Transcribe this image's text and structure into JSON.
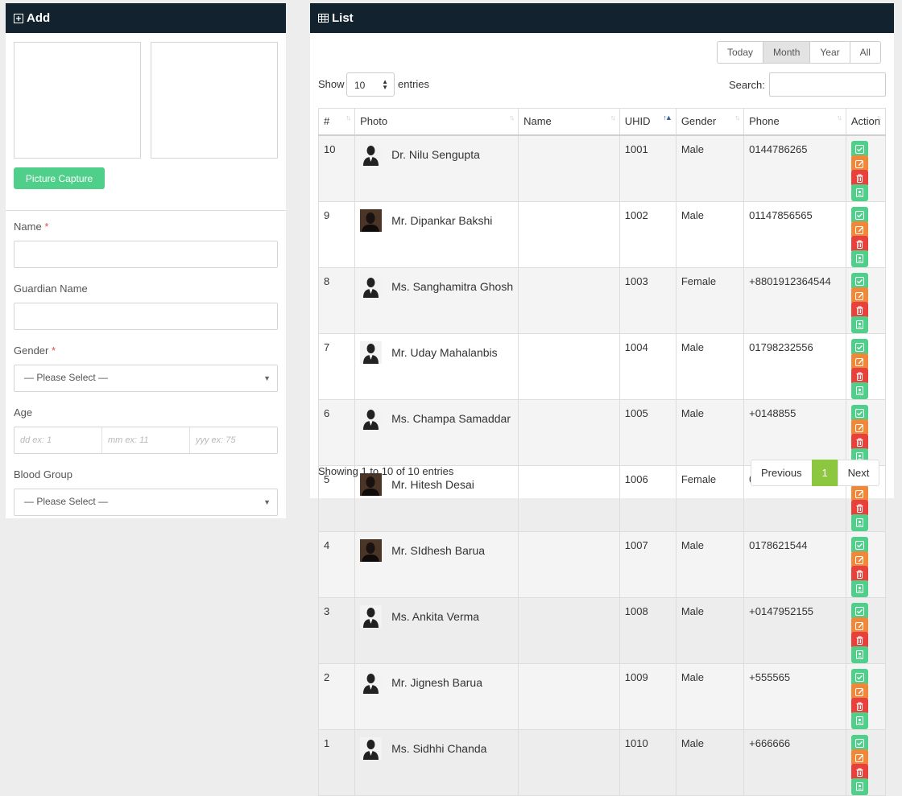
{
  "add_panel": {
    "title": "Add",
    "capture_button": "Picture Capture",
    "name_label": "Name",
    "guardian_label": "Guardian Name",
    "gender_label": "Gender",
    "gender_value": "— Please Select —",
    "age_label": "Age",
    "age_dd_placeholder": "dd ex: 1",
    "age_mm_placeholder": "mm ex: 11",
    "age_yy_placeholder": "yyy ex: 75",
    "blood_label": "Blood Group",
    "blood_value": "— Please Select —",
    "required_mark": "*"
  },
  "list_panel": {
    "title": "List",
    "ranges": [
      "Today",
      "Month",
      "Year",
      "All"
    ],
    "active_range": "Month",
    "show_label": "Show",
    "entries_label": "entries",
    "page_length": "10",
    "search_label": "Search:",
    "columns": [
      "#",
      "Photo",
      "Name",
      "UHID",
      "Gender",
      "Phone",
      "Action"
    ],
    "rows": [
      {
        "num": "10",
        "name": "Dr. Nilu Sengupta",
        "uhid": "1001",
        "gender": "Male",
        "phone": "0144786265",
        "photo": "silhouette"
      },
      {
        "num": "9",
        "name": "Mr. Dipankar Bakshi",
        "uhid": "1002",
        "gender": "Male",
        "phone": "01147856565",
        "photo": "photo"
      },
      {
        "num": "8",
        "name": "Ms. Sanghamitra Ghosh",
        "uhid": "1003",
        "gender": "Female",
        "phone": "+8801912364544",
        "photo": "silhouette"
      },
      {
        "num": "7",
        "name": "Mr. Uday Mahalanbis",
        "uhid": "1004",
        "gender": "Male",
        "phone": "01798232556",
        "photo": "silhouette"
      },
      {
        "num": "6",
        "name": "Ms. Champa Samaddar",
        "uhid": "1005",
        "gender": "Male",
        "phone": "+0148855",
        "photo": "silhouette"
      },
      {
        "num": "5",
        "name": "Mr. Hitesh Desai",
        "uhid": "1006",
        "gender": "Female",
        "phone": "0148625552",
        "photo": "photo"
      },
      {
        "num": "4",
        "name": "Mr. SIdhesh Barua",
        "uhid": "1007",
        "gender": "Male",
        "phone": "0178621544",
        "photo": "photo"
      },
      {
        "num": "3",
        "name": "Ms. Ankita Verma",
        "uhid": "1008",
        "gender": "Male",
        "phone": "+0147952155",
        "photo": "silhouette"
      },
      {
        "num": "2",
        "name": "Mr. Jignesh Barua",
        "uhid": "1009",
        "gender": "Male",
        "phone": "+555565",
        "photo": "silhouette"
      },
      {
        "num": "1",
        "name": "Ms. Sidhhi Chanda",
        "uhid": "1010",
        "gender": "Male",
        "phone": "+666666",
        "photo": "silhouette"
      }
    ],
    "actions": [
      "check-icon",
      "edit-icon",
      "trash-icon",
      "id-card-icon"
    ],
    "info": "Showing 1 to 10 of 10 entries",
    "pagination": {
      "previous": "Previous",
      "current": "1",
      "next": "Next"
    },
    "colors": {
      "header_bg": "#13222f",
      "green": "#4fcf8a",
      "orange": "#f0883a",
      "red": "#e8413b",
      "page_active": "#8dc63f"
    }
  }
}
